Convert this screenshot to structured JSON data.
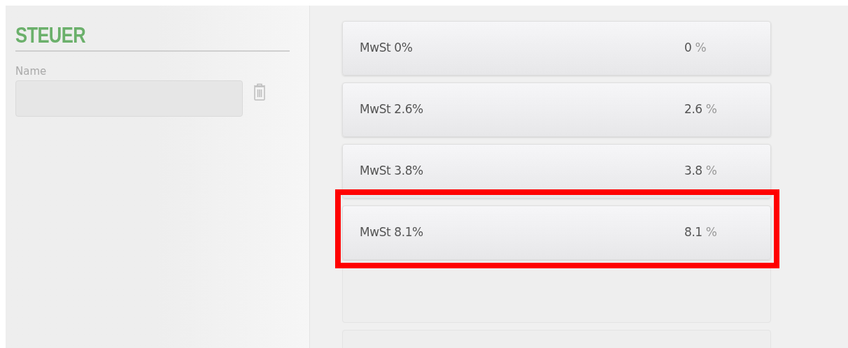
{
  "section": {
    "title": "STEUER",
    "name_label": "Name"
  },
  "taxes": [
    {
      "kind": "rate",
      "label": "MwSt 0%",
      "value": "0",
      "unit": "%",
      "highlighted": false
    },
    {
      "kind": "rate",
      "label": "MwSt 2.6%",
      "value": "2.6",
      "unit": "%",
      "highlighted": false
    },
    {
      "kind": "rate",
      "label": "MwSt 3.8%",
      "value": "3.8",
      "unit": "%",
      "highlighted": false
    },
    {
      "kind": "rate",
      "label": "MwSt 8.1%",
      "value": "8.1",
      "unit": "%",
      "highlighted": true
    },
    {
      "kind": "empty"
    },
    {
      "kind": "empty"
    }
  ]
}
